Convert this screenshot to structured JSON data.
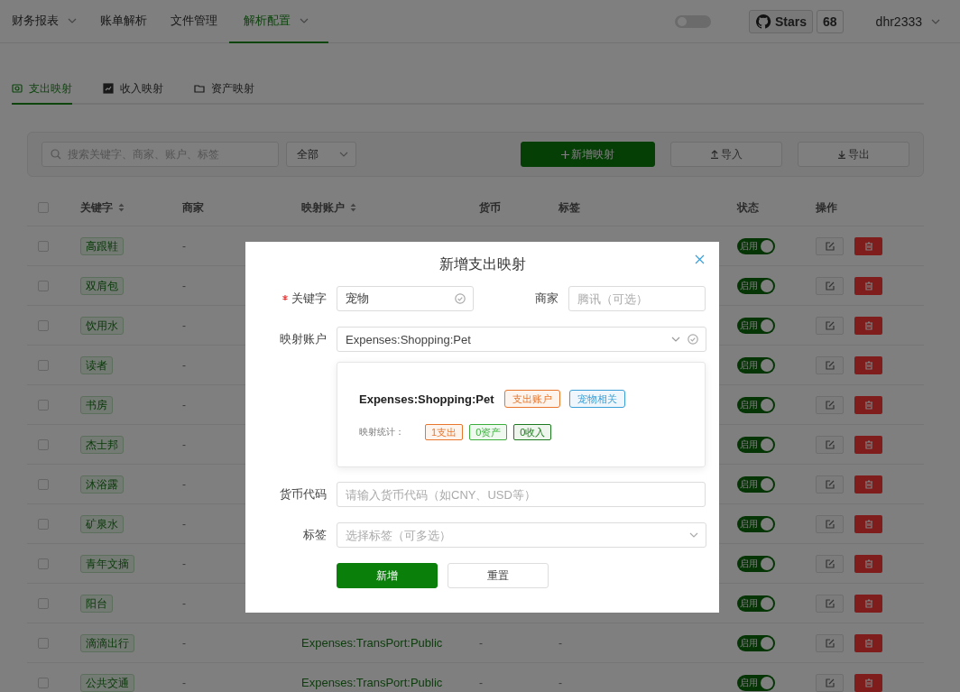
{
  "nav": {
    "items": [
      {
        "label": "财务报表",
        "has_menu": true,
        "selected": false
      },
      {
        "label": "账单解析",
        "has_menu": false,
        "selected": false
      },
      {
        "label": "文件管理",
        "has_menu": false,
        "selected": false
      },
      {
        "label": "解析配置",
        "has_menu": true,
        "selected": true
      }
    ],
    "theme_switch": {
      "on": false
    },
    "github": {
      "label": "Stars",
      "count": "68"
    },
    "user": {
      "name": "dhr2333"
    }
  },
  "tabs": [
    {
      "label": "支出映射",
      "selected": true
    },
    {
      "label": "收入映射",
      "selected": false
    },
    {
      "label": "资产映射",
      "selected": false
    }
  ],
  "toolbar": {
    "search": {
      "placeholder": "搜索关键字、商家、账户、标签"
    },
    "filter": {
      "value": "全部"
    },
    "buttons": [
      {
        "label": "新增映射",
        "kind": "primary"
      },
      {
        "label": "导入",
        "kind": "import"
      },
      {
        "label": "导出",
        "kind": "export"
      }
    ]
  },
  "table": {
    "select_all": false,
    "columns": [
      {
        "label": "关键字",
        "sortable": true
      },
      {
        "label": "商家",
        "sortable": false
      },
      {
        "label": "映射账户",
        "sortable": true
      },
      {
        "label": "货币",
        "sortable": false
      },
      {
        "label": "标签",
        "sortable": false
      },
      {
        "label": "状态",
        "sortable": false
      },
      {
        "label": "操作",
        "sortable": false
      }
    ],
    "rows": [
      {
        "checked": false,
        "keyword": "高跟鞋",
        "merchant": "-",
        "enabled": true,
        "status": "启用"
      },
      {
        "checked": false,
        "keyword": "双肩包",
        "merchant": "-",
        "enabled": true,
        "status": "启用"
      },
      {
        "checked": false,
        "keyword": "饮用水",
        "merchant": "-",
        "enabled": true,
        "status": "启用"
      },
      {
        "checked": false,
        "keyword": "读者",
        "merchant": "-",
        "enabled": true,
        "status": "启用"
      },
      {
        "checked": false,
        "keyword": "书房",
        "merchant": "-",
        "enabled": true,
        "status": "启用"
      },
      {
        "checked": false,
        "keyword": "杰士邦",
        "merchant": "-",
        "enabled": true,
        "status": "启用"
      },
      {
        "checked": false,
        "keyword": "沐浴露",
        "merchant": "-",
        "enabled": true,
        "status": "启用"
      },
      {
        "checked": false,
        "keyword": "矿泉水",
        "merchant": "-",
        "enabled": true,
        "status": "启用"
      },
      {
        "checked": false,
        "keyword": "青年文摘",
        "merchant": "-",
        "enabled": true,
        "status": "启用"
      },
      {
        "checked": false,
        "keyword": "阳台",
        "merchant": "-",
        "enabled": true,
        "status": "启用"
      },
      {
        "checked": false,
        "keyword": "滴滴出行",
        "merchant": "-",
        "account": "Expenses:TransPort:Public",
        "currency": "-",
        "tags": "-",
        "enabled": true,
        "status": "启用"
      },
      {
        "checked": false,
        "keyword": "公共交通",
        "merchant": "-",
        "account": "Expenses:TransPort:Public",
        "currency": "-",
        "tags": "-",
        "enabled": true,
        "status": "启用"
      }
    ]
  },
  "dialog": {
    "title": "新增支出映射",
    "keyword": {
      "label": "关键字",
      "required": true,
      "value": "宠物",
      "valid": true
    },
    "merchant": {
      "label": "商家",
      "required": false,
      "placeholder": "腾讯（可选）"
    },
    "account": {
      "label": "映射账户",
      "required": false,
      "value": "Expenses:Shopping:Pet",
      "valid": true
    },
    "preview": {
      "account": "Expenses:Shopping:Pet",
      "tags": [
        {
          "label": "支出账户",
          "color": "#e8762c"
        },
        {
          "label": "宠物相关",
          "color": "#3a9fd6"
        }
      ],
      "stats_label": "映射统计：",
      "stats": [
        {
          "label": "1支出",
          "color": "#e8762c"
        },
        {
          "label": "0资产",
          "color": "#3cae3c"
        },
        {
          "label": "0收入",
          "color": "#1e7a1e"
        }
      ]
    },
    "currency": {
      "label": "货币代码",
      "required": false,
      "placeholder": "请输入货币代码（如CNY、USD等）"
    },
    "tags": {
      "label": "标签",
      "required": false,
      "placeholder": "选择标签（可多选）"
    },
    "buttons": [
      {
        "label": "新增",
        "kind": "primary"
      },
      {
        "label": "重置",
        "kind": "default"
      }
    ]
  }
}
